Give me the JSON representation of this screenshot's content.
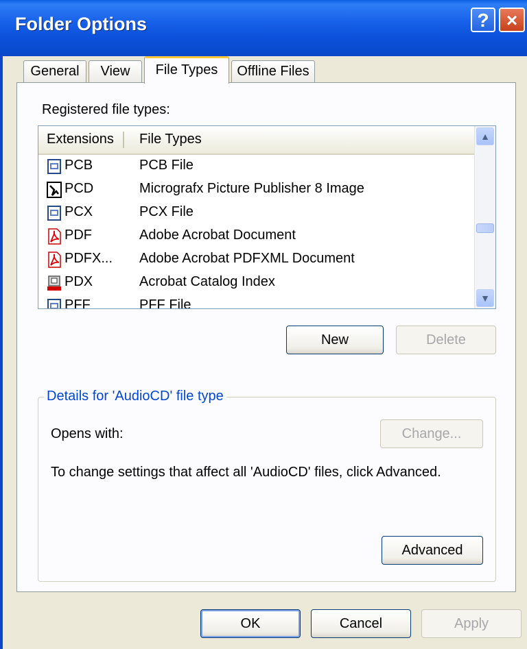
{
  "window": {
    "title": "Folder Options",
    "help_glyph": "?",
    "close_glyph": "×"
  },
  "tabs": [
    {
      "label": "General"
    },
    {
      "label": "View"
    },
    {
      "label": "File Types"
    },
    {
      "label": "Offline Files"
    }
  ],
  "active_tab": "File Types",
  "file_types": {
    "list_label": "Registered file types:",
    "columns": [
      "Extensions",
      "File Types"
    ],
    "rows": [
      {
        "ext": "PCB",
        "type": "PCB File",
        "icon": "generic-file-icon"
      },
      {
        "ext": "PCD",
        "type": "Micrografx Picture Publisher 8 Image",
        "icon": "picture-publisher-icon"
      },
      {
        "ext": "PCX",
        "type": "PCX File",
        "icon": "generic-file-icon"
      },
      {
        "ext": "PDF",
        "type": "Adobe Acrobat Document",
        "icon": "pdf-icon"
      },
      {
        "ext": "PDFX...",
        "type": "Adobe Acrobat PDFXML Document",
        "icon": "pdf-icon"
      },
      {
        "ext": "PDX",
        "type": "Acrobat Catalog Index",
        "icon": "catalog-index-icon"
      },
      {
        "ext": "PFF",
        "type": "PFF File",
        "icon": "generic-file-icon"
      }
    ],
    "new_button": "New",
    "delete_button": "Delete"
  },
  "details": {
    "group_title": "Details for 'AudioCD' file type",
    "opens_with_label": "Opens with:",
    "change_button": "Change...",
    "description": "To change settings that affect all 'AudioCD' files, click Advanced.",
    "advanced_button": "Advanced"
  },
  "footer": {
    "ok": "OK",
    "cancel": "Cancel",
    "apply": "Apply"
  },
  "colors": {
    "title_bar": "#0a5fe4",
    "dialog_bg": "#ece9d8",
    "panel_bg": "#fcfcfe",
    "group_title": "#0046d5",
    "active_tab_accent": "#ffc83c"
  }
}
